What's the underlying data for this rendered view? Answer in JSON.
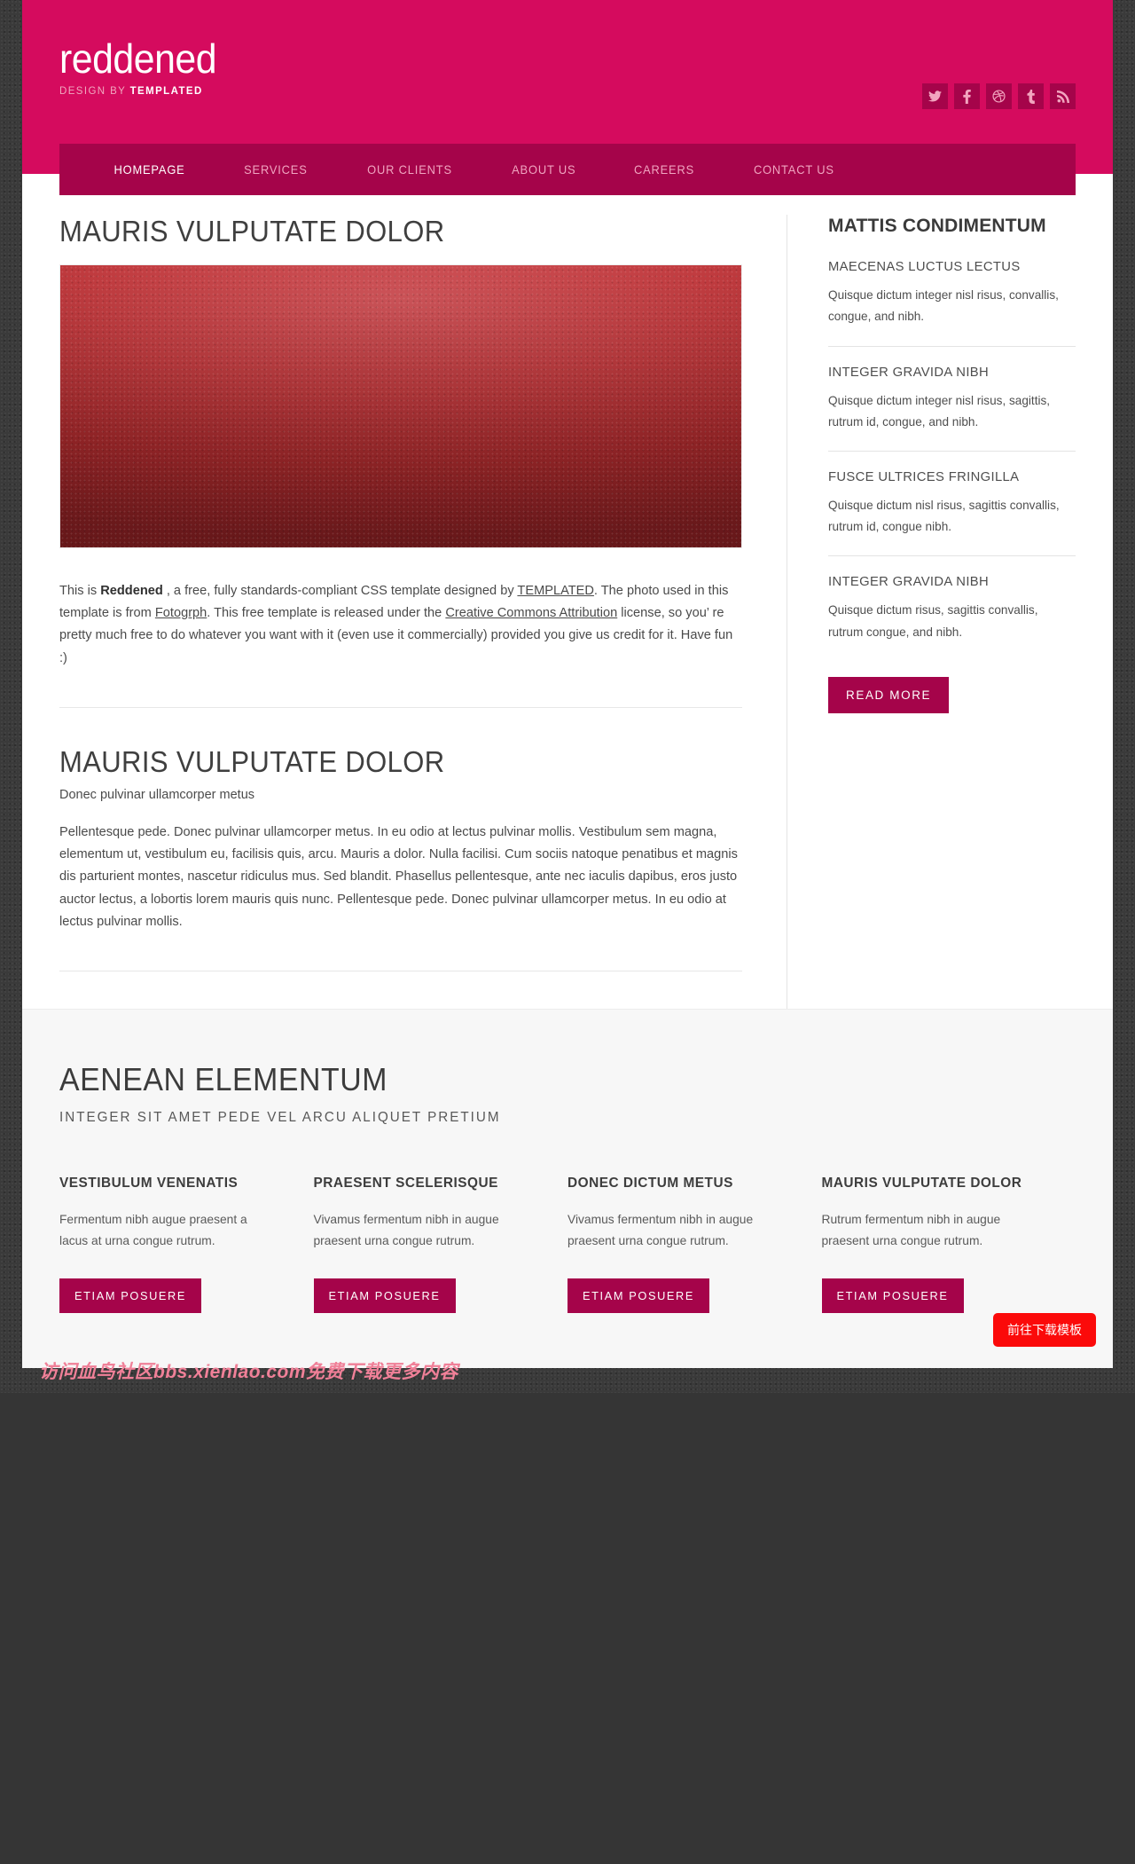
{
  "header": {
    "logo": "reddened",
    "tagline_prefix": "DESIGN BY ",
    "tagline_brand": "TEMPLATED",
    "social": [
      {
        "name": "twitter-icon",
        "label": "Twitter"
      },
      {
        "name": "facebook-icon",
        "label": "Facebook"
      },
      {
        "name": "dribbble-icon",
        "label": "Dribbble"
      },
      {
        "name": "tumblr-icon",
        "label": "Tumblr"
      },
      {
        "name": "rss-icon",
        "label": "RSS"
      }
    ]
  },
  "nav": {
    "items": [
      {
        "label": "HOMEPAGE",
        "active": true
      },
      {
        "label": "SERVICES",
        "active": false
      },
      {
        "label": "OUR CLIENTS",
        "active": false
      },
      {
        "label": "ABOUT US",
        "active": false
      },
      {
        "label": "CAREERS",
        "active": false
      },
      {
        "label": "CONTACT US",
        "active": false
      }
    ]
  },
  "main": {
    "heading_1": "MAURIS VULPUTATE DOLOR",
    "intro": {
      "seg1": "This is ",
      "bold": "Reddened",
      "seg2": " , a free, fully standards-compliant CSS template designed by ",
      "link1": "TEMPLATED",
      "seg3": ". The photo used in this template is from ",
      "link2": "Fotogrph",
      "seg4": ". This free template is released under the ",
      "link3": "Creative Commons Attribution",
      "seg5": " license, so you’ re pretty much free to do whatever you want with it (even use it commercially) provided you give us credit for it. Have fun :)"
    },
    "heading_2": "MAURIS VULPUTATE DOLOR",
    "subtitle_2": "Donec pulvinar ullamcorper metus",
    "body_2": "Pellentesque pede. Donec pulvinar ullamcorper metus. In eu odio at lectus pulvinar mollis. Vestibulum sem magna, elementum ut, vestibulum eu, facilisis quis, arcu. Mauris a dolor. Nulla facilisi. Cum sociis natoque penatibus et magnis dis parturient montes, nascetur ridiculus mus. Sed blandit. Phasellus pellentesque, ante nec iaculis dapibus, eros justo auctor lectus, a lobortis lorem mauris quis nunc. Pellentesque pede. Donec pulvinar ullamcorper metus. In eu odio at lectus pulvinar mollis."
  },
  "sidebar": {
    "title": "MATTIS CONDIMENTUM",
    "items": [
      {
        "heading": "MAECENAS LUCTUS LECTUS",
        "text": "Quisque dictum integer nisl risus, convallis, congue, and nibh."
      },
      {
        "heading": "INTEGER GRAVIDA NIBH",
        "text": "Quisque dictum integer nisl risus, sagittis, rutrum id, congue, and nibh."
      },
      {
        "heading": "FUSCE ULTRICES FRINGILLA",
        "text": "Quisque dictum nisl risus, sagittis convallis, rutrum id, congue nibh."
      },
      {
        "heading": "INTEGER GRAVIDA NIBH",
        "text": "Quisque dictum risus, sagittis convallis, rutrum congue, and nibh."
      }
    ],
    "read_more": "READ MORE"
  },
  "features": {
    "title": "AENEAN ELEMENTUM",
    "subtitle": "INTEGER SIT AMET PEDE VEL ARCU ALIQUET PRETIUM",
    "columns": [
      {
        "heading": "VESTIBULUM VENENATIS",
        "text": "Fermentum nibh augue praesent a lacus at urna congue rutrum.",
        "button": "ETIAM POSUERE"
      },
      {
        "heading": "PRAESENT SCELERISQUE",
        "text": "Vivamus fermentum nibh in augue praesent urna congue rutrum.",
        "button": "ETIAM POSUERE"
      },
      {
        "heading": "DONEC DICTUM METUS",
        "text": "Vivamus fermentum nibh in augue praesent urna congue rutrum.",
        "button": "ETIAM POSUERE"
      },
      {
        "heading": "MAURIS VULPUTATE DOLOR",
        "text": "Rutrum fermentum nibh in augue praesent urna congue rutrum.",
        "button": "ETIAM POSUERE"
      }
    ]
  },
  "overlay": {
    "watermark": "访问血鸟社区bbs.xienlao.com免费下载更多内容",
    "download_button": "前往下载模板"
  },
  "colors": {
    "header_pink": "#d50b5e",
    "nav_dark_pink": "#a5044a",
    "accent_button": "#a5044a",
    "download_red": "#fb0a0a",
    "watermark_pink": "#f08098"
  }
}
